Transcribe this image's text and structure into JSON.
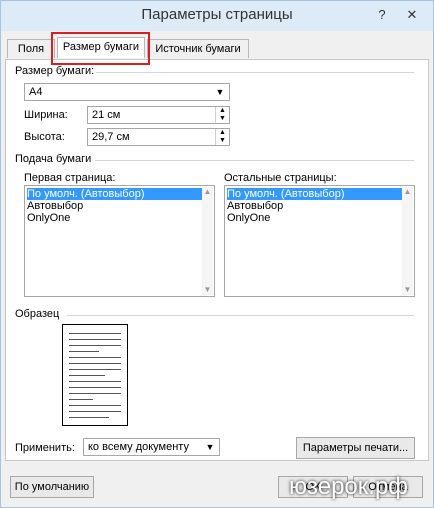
{
  "window": {
    "title": "Параметры страницы",
    "help_label": "?",
    "close_label": "✕"
  },
  "tabs": [
    {
      "label": "Поля",
      "active": false
    },
    {
      "label": "Размер бумаги",
      "active": true
    },
    {
      "label": "Источник бумаги",
      "active": false
    }
  ],
  "paper_size": {
    "section_label": "Размер бумаги:",
    "selected": "A4",
    "width_label": "Ширина:",
    "width_value": "21 см",
    "height_label": "Высота:",
    "height_value": "29,7 см"
  },
  "paper_feed": {
    "section_label": "Подача бумаги",
    "first_page_label": "Первая страница:",
    "other_pages_label": "Остальные страницы:",
    "first_page_items": [
      "По умолч. (Автовыбор)",
      "Автовыбор",
      "OnlyOne"
    ],
    "other_pages_items": [
      "По умолч. (Автовыбор)",
      "Автовыбор",
      "OnlyOne"
    ]
  },
  "sample": {
    "section_label": "Образец"
  },
  "apply": {
    "label": "Применить:",
    "selected": "ко всему документу"
  },
  "buttons": {
    "print_options": "Параметры печати...",
    "default": "По умолчанию",
    "ok": "ОК",
    "cancel": "Отмена"
  },
  "watermark": {
    "text": "юзерок.рф"
  },
  "colors": {
    "highlight": "#d62021",
    "selection": "#3399ff"
  }
}
